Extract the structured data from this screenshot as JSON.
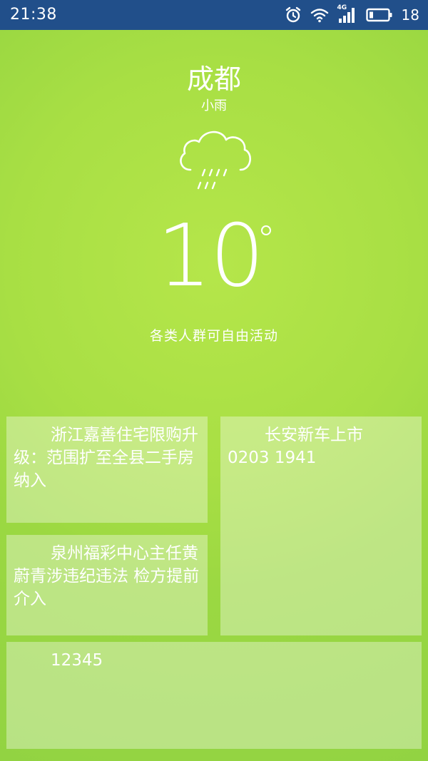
{
  "status_bar": {
    "time": "21:38",
    "network_label": "4G",
    "battery_level": "18",
    "icons": [
      "alarm-icon",
      "wifi-icon",
      "signal-icon",
      "battery-icon"
    ]
  },
  "weather": {
    "city": "成都",
    "condition": "小雨",
    "condition_icon": "rain-cloud-icon",
    "temperature": "10",
    "advice": "各类人群可自由活动"
  },
  "tiles": {
    "news_1": "浙江嘉善住宅限购升级：范围扩至全县二手房纳入",
    "news_2": "泉州福彩中心主任黄蔚青涉违纪违法 检方提前介入",
    "car_title": "长安新车上市",
    "car_subtitle": "0203 1941",
    "bottom": "12345"
  },
  "colors": {
    "status_bar_bg": "#214f8a",
    "background": "#a8df44",
    "text": "#ffffff"
  }
}
